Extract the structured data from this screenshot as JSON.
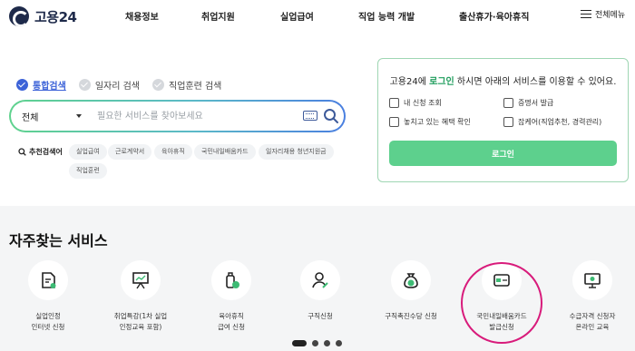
{
  "header": {
    "logo_text": "고용24",
    "nav": [
      {
        "label": "채용정보"
      },
      {
        "label": "취업지원"
      },
      {
        "label": "실업급여"
      },
      {
        "label": "직업 능력 개발"
      },
      {
        "label": "출산휴가·육아휴직"
      }
    ],
    "menu_label": "전체메뉴"
  },
  "search": {
    "scopes": [
      {
        "label": "통합검색",
        "active": true
      },
      {
        "label": "일자리 검색",
        "active": false
      },
      {
        "label": "직업훈련 검색",
        "active": false
      }
    ],
    "select_value": "전체",
    "placeholder": "필요한 서비스를 찾아보세요",
    "recommend_title": "추천검색어",
    "tags": [
      "실업급여",
      "근로계약서",
      "육아휴직",
      "국민내일배움카드",
      "일자리채용 청년지원금",
      "직업훈련"
    ]
  },
  "login_card": {
    "prefix": "고용24에 ",
    "link": "로그인",
    "suffix": " 하시면 아래의 서비스를 이용할 수 있어요.",
    "services": [
      {
        "label": "내 신청 조회",
        "icon": "list-icon"
      },
      {
        "label": "증명서 발급",
        "icon": "certificate-icon"
      },
      {
        "label": "놓치고 있는 혜택 확인",
        "icon": "check-icon"
      },
      {
        "label": "잡케어(직업추천, 경력관리)",
        "icon": "jobcare-icon"
      }
    ],
    "button": "로그인"
  },
  "frequent": {
    "title": "자주찾는 서비스",
    "items": [
      {
        "label": "실업인정\n인터넷 신청",
        "icon": "document-icon"
      },
      {
        "label": "취업특강(1차 실업\n인정교육 포함)",
        "icon": "presentation-icon"
      },
      {
        "label": "육아휴직\n급여 신청",
        "icon": "baby-bottle-icon"
      },
      {
        "label": "구직신청",
        "icon": "person-icon"
      },
      {
        "label": "구직촉진수당 신청",
        "icon": "money-bag-icon"
      },
      {
        "label": "국민내일배움카드\n발급신청",
        "icon": "card-icon"
      },
      {
        "label": "수급자격 신청자\n온라인 교육",
        "icon": "monitor-icon"
      }
    ],
    "highlight_color": "#d81b7b"
  },
  "colors": {
    "brand_green": "#5dd08d",
    "brand_blue": "#3d63d8",
    "logo_navy": "#1e2a4a"
  }
}
